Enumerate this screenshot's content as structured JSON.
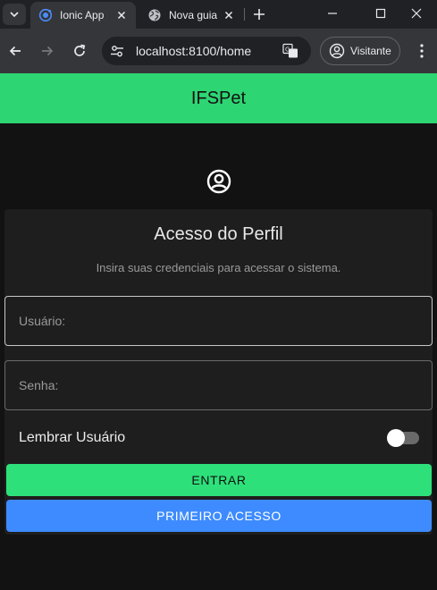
{
  "browser": {
    "tabs": [
      {
        "title": "Ionic App",
        "icon": "ionic-favicon-icon",
        "active": true
      },
      {
        "title": "Nova guia",
        "icon": "globe-icon",
        "active": false
      }
    ],
    "url_host": "localhost",
    "url_rest": ":8100/home",
    "profile_label": "Visitante"
  },
  "app": {
    "header_title": "IFSPet",
    "header_color": "#2ed573",
    "card": {
      "title": "Acesso do Perfil",
      "subtitle": "Insira suas credenciais para acessar o sistema.",
      "username_label": "Usuário:",
      "password_label": "Senha:",
      "remember_label": "Lembrar Usuário",
      "remember_checked": false,
      "login_button": "ENTRAR",
      "first_access_button": "PRIMEIRO ACESSO"
    },
    "colors": {
      "primary_green": "#2ee07a",
      "primary_blue": "#3d8bff",
      "background": "#121212",
      "card": "#1e1e1e"
    }
  }
}
